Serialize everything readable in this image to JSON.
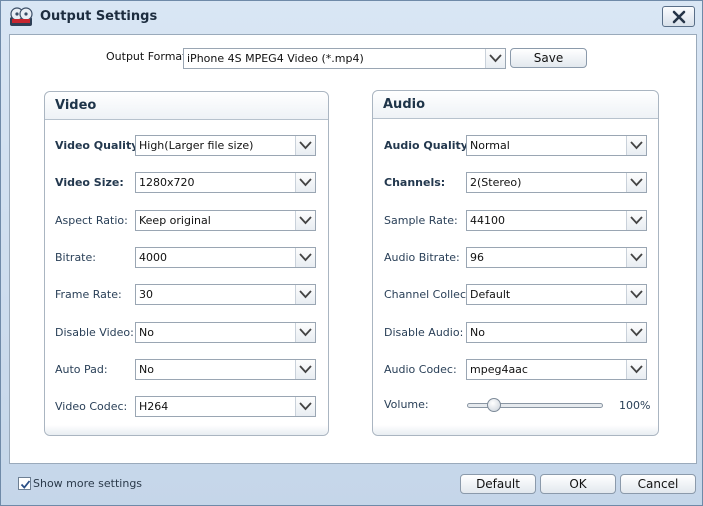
{
  "window": {
    "title": "Output Settings",
    "close_icon": "close-icon",
    "app_icon": "film-reel-icon"
  },
  "format": {
    "label": "Output Format:",
    "value": "iPhone 4S MPEG4 Video (*.mp4)",
    "save_label": "Save"
  },
  "video": {
    "title": "Video",
    "fields": [
      {
        "label": "Video Quality:",
        "value": "High(Larger file size)",
        "bold": true
      },
      {
        "label": "Video Size:",
        "value": "1280x720",
        "bold": true
      },
      {
        "label": "Aspect Ratio:",
        "value": "Keep original",
        "bold": false
      },
      {
        "label": "Bitrate:",
        "value": "4000",
        "bold": false
      },
      {
        "label": "Frame Rate:",
        "value": "30",
        "bold": false
      },
      {
        "label": "Disable Video:",
        "value": "No",
        "bold": false
      },
      {
        "label": "Auto Pad:",
        "value": "No",
        "bold": false
      },
      {
        "label": "Video Codec:",
        "value": "H264",
        "bold": false
      }
    ]
  },
  "audio": {
    "title": "Audio",
    "fields": [
      {
        "label": "Audio Quality:",
        "value": "Normal",
        "bold": true
      },
      {
        "label": "Channels:",
        "value": "2(Stereo)",
        "bold": true
      },
      {
        "label": "Sample Rate:",
        "value": "44100",
        "bold": false
      },
      {
        "label": "Audio Bitrate:",
        "value": "96",
        "bold": false
      },
      {
        "label": "Channel Collect:",
        "value": "Default",
        "bold": false
      },
      {
        "label": "Disable Audio:",
        "value": "No",
        "bold": false
      },
      {
        "label": "Audio Codec:",
        "value": "mpeg4aac",
        "bold": false
      }
    ],
    "volume": {
      "label": "Volume:",
      "value": "100%",
      "level": 0.2
    }
  },
  "footer": {
    "show_more_label": "Show more settings",
    "show_more_checked": true,
    "default_label": "Default",
    "ok_label": "OK",
    "cancel_label": "Cancel"
  }
}
